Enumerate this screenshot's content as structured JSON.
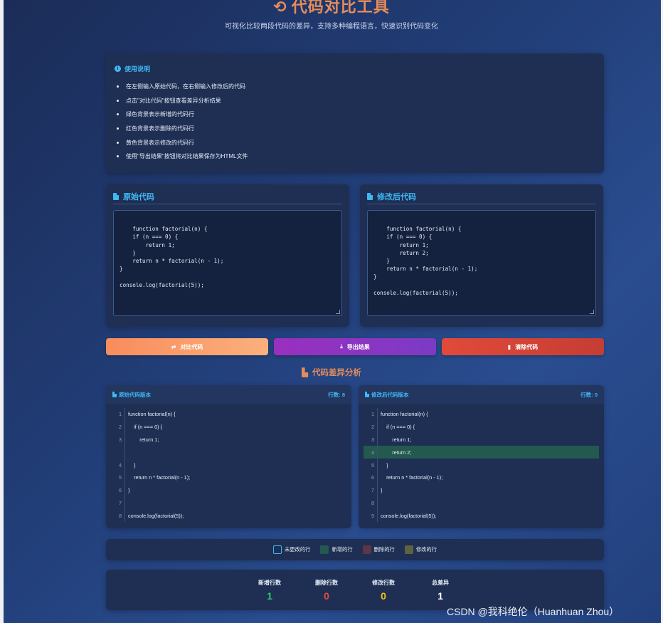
{
  "header": {
    "title": "代码对比工具",
    "subtitle": "可视化比较两段代码的差异，支持多种编程语言，快速识别代码变化"
  },
  "instructions": {
    "title": "使用说明",
    "items": [
      "在左侧输入原始代码，在右侧输入修改后的代码",
      "点击\"对比代码\"按钮查看差异分析结果",
      "绿色背景表示新增的代码行",
      "红色背景表示删除的代码行",
      "黄色背景表示修改的代码行",
      "使用\"导出结果\"按钮将对比结果保存为HTML文件"
    ]
  },
  "editors": {
    "original": {
      "title": "原始代码",
      "code": "function factorial(n) {\n    if (n === 0) {\n        return 1;\n    }\n    return n * factorial(n - 1);\n}\n\nconsole.log(factorial(5));"
    },
    "modified": {
      "title": "修改后代码",
      "code": "function factorial(n) {\n    if (n === 0) {\n        return 1;\n        return 2;\n    }\n    return n * factorial(n - 1);\n}\n\nconsole.log(factorial(5));"
    }
  },
  "buttons": {
    "compare": "对比代码",
    "export": "导出结果",
    "clear": "清除代码"
  },
  "diff": {
    "title": "代码差异分析",
    "left": {
      "title": "原始代码版本",
      "count_label": "行数: 8",
      "lines": [
        {
          "num": "1",
          "text": "function factorial(n) {",
          "state": "unchanged"
        },
        {
          "num": "2",
          "text": "    if (n === 0) {",
          "state": "unchanged"
        },
        {
          "num": "3",
          "text": "        return 1;",
          "state": "unchanged"
        },
        {
          "num": "",
          "text": "",
          "state": "placeholder"
        },
        {
          "num": "4",
          "text": "    }",
          "state": "unchanged"
        },
        {
          "num": "5",
          "text": "    return n * factorial(n - 1);",
          "state": "unchanged"
        },
        {
          "num": "6",
          "text": "}",
          "state": "unchanged"
        },
        {
          "num": "7",
          "text": "",
          "state": "unchanged"
        },
        {
          "num": "8",
          "text": "console.log(factorial(5));",
          "state": "unchanged"
        }
      ]
    },
    "right": {
      "title": "修改后代码版本",
      "count_label": "行数: 0",
      "lines": [
        {
          "num": "1",
          "text": "function factorial(n) {",
          "state": "unchanged"
        },
        {
          "num": "2",
          "text": "    if (n === 0) {",
          "state": "unchanged"
        },
        {
          "num": "3",
          "text": "        return 1;",
          "state": "unchanged"
        },
        {
          "num": "4",
          "text": "        return 2;",
          "state": "added"
        },
        {
          "num": "5",
          "text": "    }",
          "state": "unchanged"
        },
        {
          "num": "6",
          "text": "    return n * factorial(n - 1);",
          "state": "unchanged"
        },
        {
          "num": "7",
          "text": "}",
          "state": "unchanged"
        },
        {
          "num": "8",
          "text": "",
          "state": "unchanged"
        },
        {
          "num": "9",
          "text": "console.log(factorial(5));",
          "state": "unchanged"
        }
      ]
    }
  },
  "legend": {
    "unchanged": "未更改的行",
    "added": "新增的行",
    "deleted": "删除的行",
    "modified": "修改的行"
  },
  "stats": {
    "added_label": "新增行数",
    "added_value": "1",
    "deleted_label": "删除行数",
    "deleted_value": "0",
    "modified_label": "修改行数",
    "modified_value": "0",
    "total_label": "总差异",
    "total_value": "1"
  },
  "colors": {
    "added": "#2ecc71",
    "deleted": "#e74c3c",
    "modified": "#f1c40f",
    "total": "#ffffff",
    "accent": "#3fb7f4",
    "title": "#e58d5a"
  },
  "watermark": "CSDN @我科绝伦（Huanhuan Zhou）"
}
